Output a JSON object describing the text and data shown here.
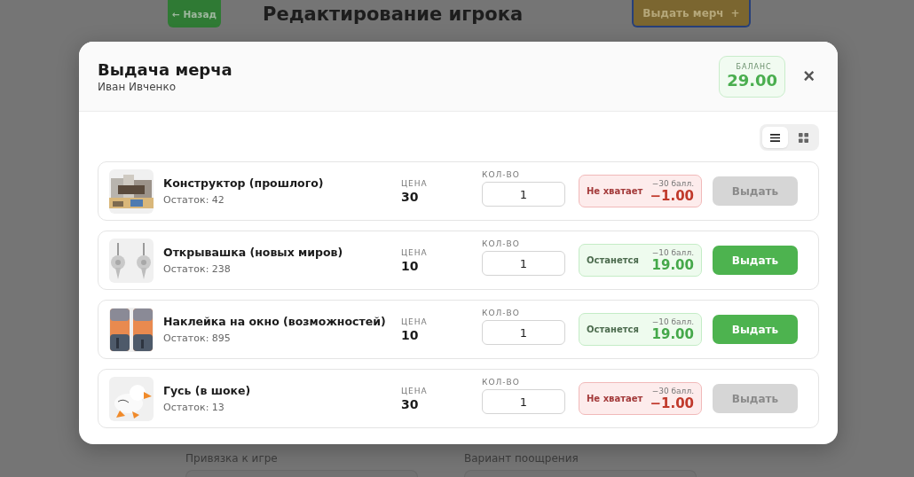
{
  "page": {
    "back_button": "← Назад",
    "title": "Редактирование игрока",
    "merch_button": "Выдать мерч",
    "merch_button_icon": "+",
    "fields": [
      {
        "label": "Привязка к игре"
      },
      {
        "label": "Вариант поощрения"
      }
    ]
  },
  "dialog": {
    "title": "Выдача мерча",
    "subtitle": "Иван Ивченко",
    "balance_label": "БАЛАНС",
    "balance": "29.00",
    "close": "×",
    "view_toggle": [
      {
        "kind": "list",
        "selected": true
      },
      {
        "kind": "grid",
        "selected": false
      }
    ],
    "items": [
      {
        "name": "Конструктор (прошлого)",
        "stock": "Остаток: 42",
        "price_label": "ЦЕНА",
        "price": "30",
        "qty_label": "КОЛ-ВО",
        "qty": "1",
        "status": {
          "kind": "short",
          "label": "Не хватает",
          "cost": "−30 балл.",
          "result": "−1.00"
        },
        "button": "Выдать",
        "disabled": true
      },
      {
        "name": "Открывашка (новых миров)",
        "stock": "Остаток: 238",
        "price_label": "ЦЕНА",
        "price": "10",
        "qty_label": "КОЛ-ВО",
        "qty": "1",
        "status": {
          "kind": "remain",
          "label": "Останется",
          "cost": "−10 балл.",
          "result": "19.00"
        },
        "button": "Выдать",
        "disabled": false
      },
      {
        "name": "Наклейка на окно (возможностей)",
        "stock": "Остаток: 895",
        "price_label": "ЦЕНА",
        "price": "10",
        "qty_label": "КОЛ-ВО",
        "qty": "1",
        "status": {
          "kind": "remain",
          "label": "Останется",
          "cost": "−10 балл.",
          "result": "19.00"
        },
        "button": "Выдать",
        "disabled": false
      },
      {
        "name": "Гусь (в шоке)",
        "stock": "Остаток: 13",
        "price_label": "ЦЕНА",
        "price": "30",
        "qty_label": "КОЛ-ВО",
        "qty": "1",
        "status": {
          "kind": "short",
          "label": "Не хватает",
          "cost": "−30 балл.",
          "result": "−1.00"
        },
        "button": "Выдать",
        "disabled": true
      }
    ]
  }
}
